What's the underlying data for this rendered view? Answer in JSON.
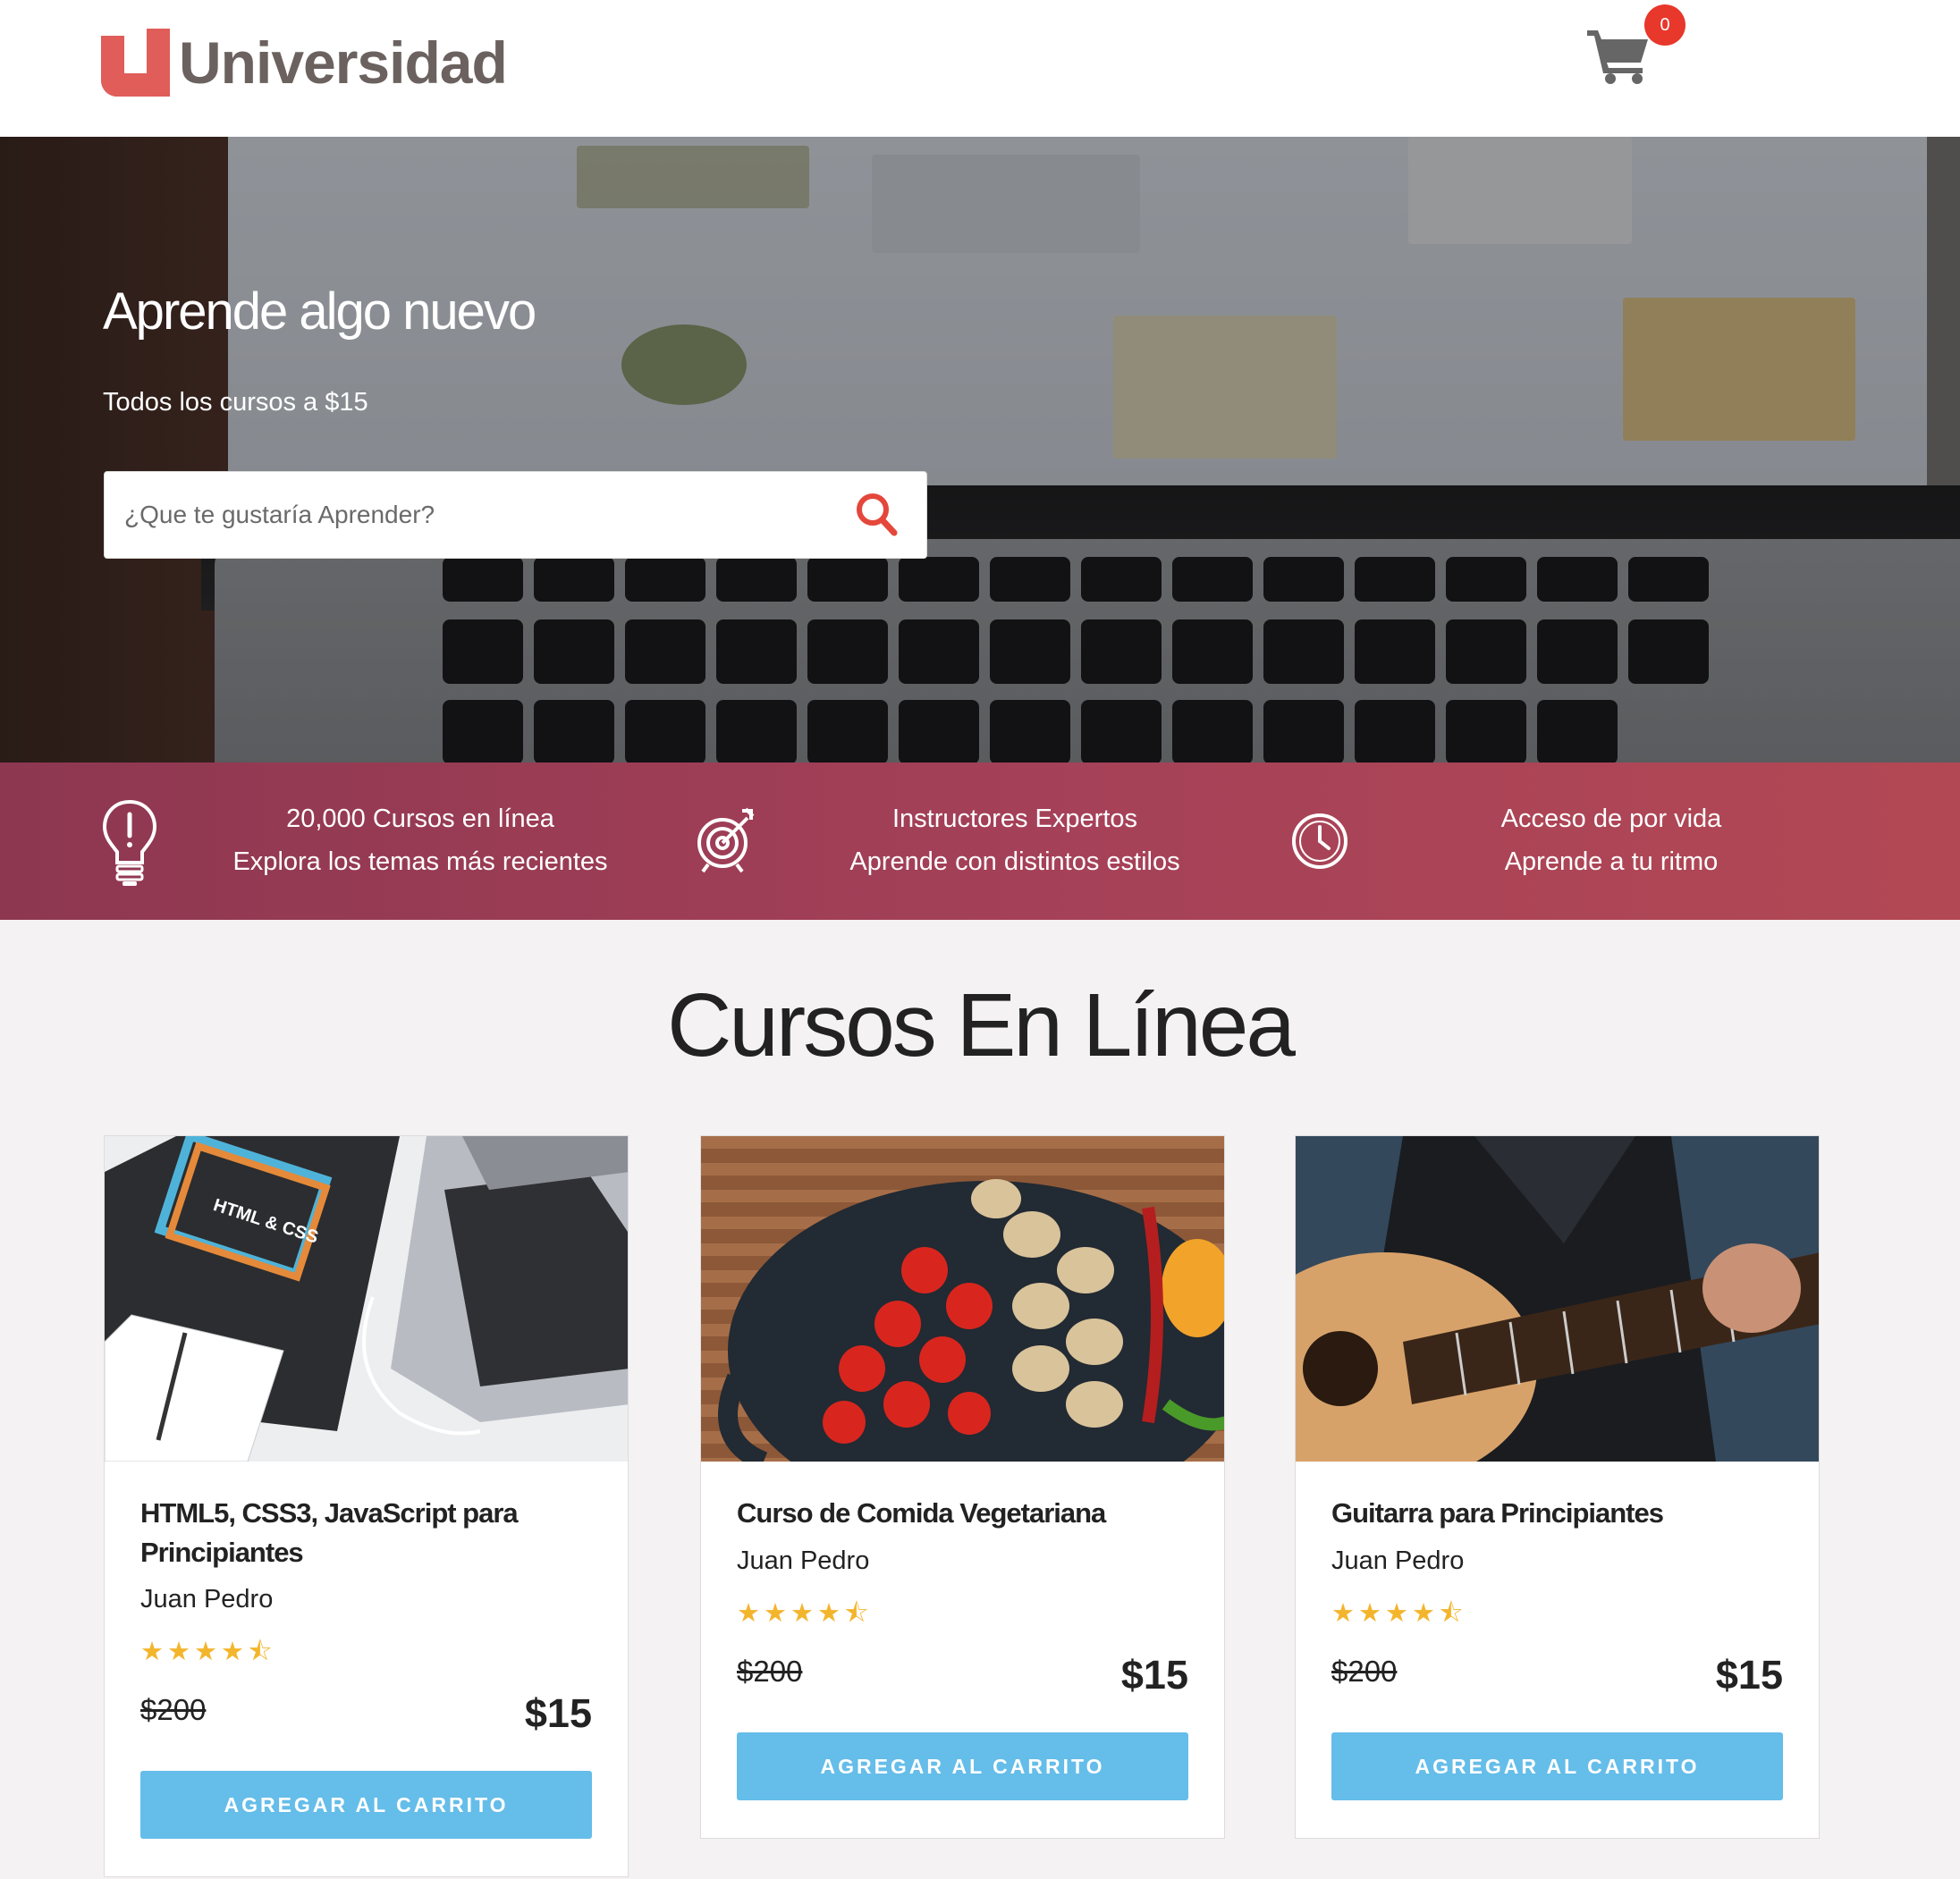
{
  "brand": {
    "name": "Universidad",
    "accent": "#e05d59"
  },
  "cart": {
    "count": "0",
    "icon": "shopping-cart-icon",
    "badge_color": "#e8372b"
  },
  "hero": {
    "title": "Aprende algo nuevo",
    "subtitle": "Todos los cursos a $15",
    "search": {
      "placeholder": "¿Que te gustaría Aprender?",
      "value": "",
      "icon": "search-icon"
    }
  },
  "features": [
    {
      "icon": "lightbulb-icon",
      "line1": "20,000 Cursos en línea",
      "line2": "Explora los temas más recientes"
    },
    {
      "icon": "target-icon",
      "line1": "Instructores Expertos",
      "line2": "Aprende con distintos estilos"
    },
    {
      "icon": "clock-icon",
      "line1": "Acceso de por vida",
      "line2": "Aprende a tu ritmo"
    }
  ],
  "section": {
    "title": "Cursos En Línea"
  },
  "courses": [
    {
      "title": "HTML5, CSS3, JavaScript para Principiantes",
      "author": "Juan Pedro",
      "rating": 4.5,
      "stars": "★★★★⯪",
      "old_price": "$200",
      "price": "$15",
      "button": "AGREGAR AL CARRITO"
    },
    {
      "title": "Curso de Comida Vegetariana",
      "author": "Juan Pedro",
      "rating": 4.5,
      "stars": "★★★★⯪",
      "old_price": "$200",
      "price": "$15",
      "button": "AGREGAR AL CARRITO"
    },
    {
      "title": "Guitarra para Principiantes",
      "author": "Juan Pedro",
      "rating": 4.5,
      "stars": "★★★★⯪",
      "old_price": "$200",
      "price": "$15",
      "button": "AGREGAR AL CARRITO"
    }
  ],
  "colors": {
    "feature_bar": "#a54158",
    "button": "#65bde9",
    "stars": "#f3b52c"
  }
}
